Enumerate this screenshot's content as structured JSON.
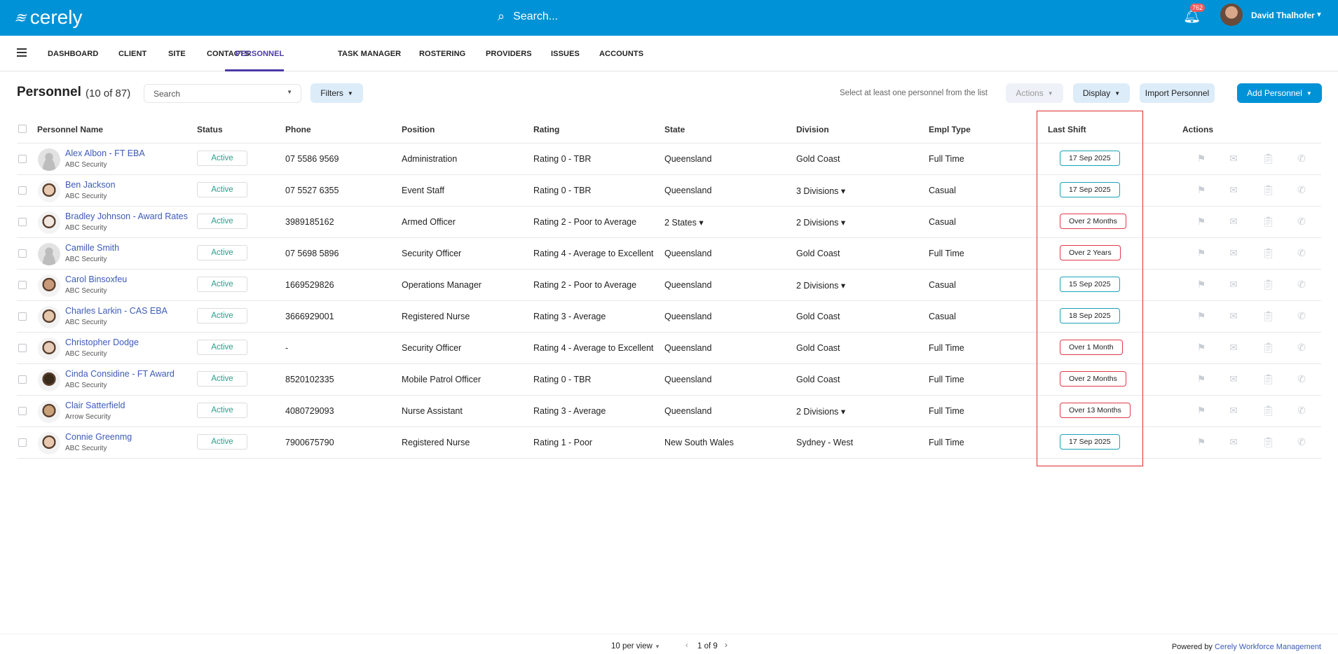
{
  "header": {
    "logo": "cerely",
    "search_placeholder": "Search...",
    "notification_count": "762",
    "user_name": "David Thalhofer"
  },
  "nav": [
    "DASHBOARD",
    "CLIENT",
    "SITE",
    "CONTACTS",
    "PERSONNEL",
    "TASK MANAGER",
    "ROSTERING",
    "PROVIDERS",
    "ISSUES",
    "ACCOUNTS"
  ],
  "page": {
    "title": "Personnel",
    "count": "(10 of 87)",
    "search_placeholder": "Search",
    "filters": "Filters",
    "hint": "Select at least one personnel from the list",
    "actions": "Actions",
    "display": "Display",
    "import": "Import Personnel",
    "add": "Add Personnel"
  },
  "columns": [
    "Personnel Name",
    "Status",
    "Phone",
    "Position",
    "Rating",
    "State",
    "Division",
    "Empl Type",
    "Last Shift",
    "Actions"
  ],
  "rows": [
    {
      "name": "Alex Albon - FT EBA",
      "company": "ABC Security",
      "status": "Active",
      "phone": "07 5586 9569",
      "position": "Administration",
      "rating": "Rating 0 - TBR",
      "state": "Queensland",
      "division": "Gold Coast",
      "empl": "Full Time",
      "shift": "17 Sep 2025",
      "overdue": false,
      "avatar": "placeholder"
    },
    {
      "name": "Ben Jackson",
      "company": "ABC Security",
      "status": "Active",
      "phone": "07 5527 6355",
      "position": "Event Staff",
      "rating": "Rating 0 - TBR",
      "state": "Queensland",
      "division": "3 Divisions",
      "empl": "Casual",
      "shift": "17 Sep 2025",
      "overdue": false,
      "avatar": "photo"
    },
    {
      "name": "Bradley Johnson - Award Rates",
      "company": "ABC Security",
      "status": "Active",
      "phone": "3989185162",
      "position": "Armed Officer",
      "rating": "Rating 2 - Poor to Average",
      "state": "2 States",
      "division": "2 Divisions",
      "empl": "Casual",
      "shift": "Over 2 Months",
      "overdue": true,
      "avatar": "photo"
    },
    {
      "name": "Camille Smith",
      "company": "ABC Security",
      "status": "Active",
      "phone": "07 5698 5896",
      "position": "Security Officer",
      "rating": "Rating 4 - Average to Excellent",
      "state": "Queensland",
      "division": "Gold Coast",
      "empl": "Full Time",
      "shift": "Over 2 Years",
      "overdue": true,
      "avatar": "placeholder"
    },
    {
      "name": "Carol Binsoxfeu",
      "company": "ABC Security",
      "status": "Active",
      "phone": "1669529826",
      "position": "Operations Manager",
      "rating": "Rating 2 - Poor to Average",
      "state": "Queensland",
      "division": "2 Divisions",
      "empl": "Casual",
      "shift": "15 Sep 2025",
      "overdue": false,
      "avatar": "photo"
    },
    {
      "name": "Charles Larkin - CAS EBA",
      "company": "ABC Security",
      "status": "Active",
      "phone": "3666929001",
      "position": "Registered Nurse",
      "rating": "Rating 3 - Average",
      "state": "Queensland",
      "division": "Gold Coast",
      "empl": "Casual",
      "shift": "18 Sep 2025",
      "overdue": false,
      "avatar": "photo"
    },
    {
      "name": "Christopher Dodge",
      "company": "ABC Security",
      "status": "Active",
      "phone": "-",
      "position": "Security Officer",
      "rating": "Rating 4 - Average to Excellent",
      "state": "Queensland",
      "division": "Gold Coast",
      "empl": "Full Time",
      "shift": "Over 1 Month",
      "overdue": true,
      "avatar": "photo"
    },
    {
      "name": "Cinda Considine - FT Award",
      "company": "ABC Security",
      "status": "Active",
      "phone": "8520102335",
      "position": "Mobile Patrol Officer",
      "rating": "Rating 0 - TBR",
      "state": "Queensland",
      "division": "Gold Coast",
      "empl": "Full Time",
      "shift": "Over 2 Months",
      "overdue": true,
      "avatar": "photo"
    },
    {
      "name": "Clair Satterfield",
      "company": "Arrow Security",
      "status": "Active",
      "phone": "4080729093",
      "position": "Nurse Assistant",
      "rating": "Rating 3 - Average",
      "state": "Queensland",
      "division": "2 Divisions",
      "empl": "Full Time",
      "shift": "Over 13 Months",
      "overdue": true,
      "avatar": "photo"
    },
    {
      "name": "Connie Greenmg",
      "company": "ABC Security",
      "status": "Active",
      "phone": "7900675790",
      "position": "Registered Nurse",
      "rating": "Rating 1 - Poor",
      "state": "New South Wales",
      "division": "Sydney - West",
      "empl": "Full Time",
      "shift": "17 Sep 2025",
      "overdue": false,
      "avatar": "photo"
    }
  ],
  "footer": {
    "per_view": "10 per view",
    "page": "1 of 9",
    "powered": "Powered by",
    "brand": "Cerely Workforce Management"
  },
  "colors": {
    "brand": "#0092d6",
    "accent": "#4a3aa8",
    "ok": "#1aa3b8",
    "overdue": "#e03a4a"
  }
}
